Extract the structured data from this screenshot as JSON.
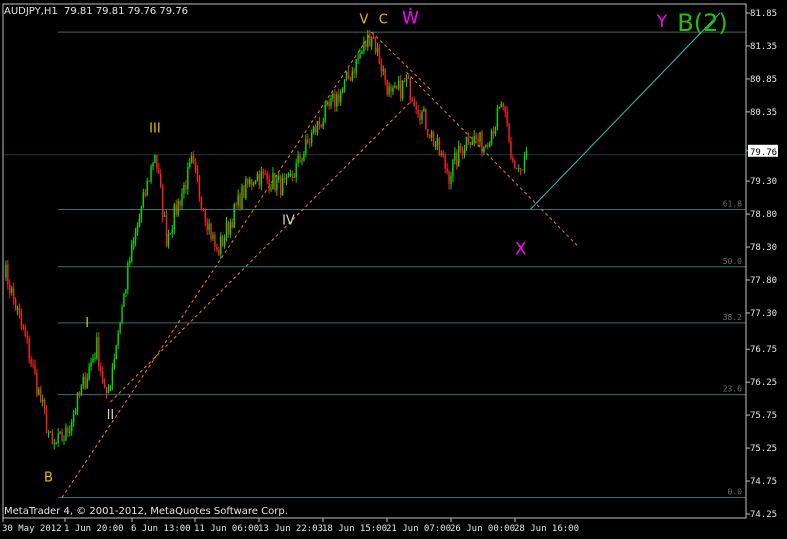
{
  "header": {
    "symbol_tf": "AUDJPY,H1",
    "ohlc": "79.81 79.81 79.76 79.76"
  },
  "footer": {
    "copyright": "MetaTrader 4, © 2001-2012, MetaQuotes Software Corp."
  },
  "colors": {
    "background": "#000000",
    "frame": "#c0c0c0",
    "bull": "#00e000",
    "bear": "#ff2020",
    "fib": "#3a6e6e",
    "fib_text": "#707070",
    "wave_main": "#e0c000",
    "wave_sub": "#d0d0d0",
    "wave_x": "#ff00ff",
    "wave_b2": "#22c000",
    "trend_dashed": "#ff8000",
    "line_cyan": "#30c0c0"
  },
  "chart_data": {
    "type": "candlestick",
    "symbol": "AUDJPY",
    "timeframe": "H1",
    "current_price": 79.76,
    "ylim": [
      74.25,
      81.85
    ],
    "y_ticks": [
      "81.85",
      "81.35",
      "80.85",
      "80.35",
      "79.76",
      "79.30",
      "78.80",
      "78.30",
      "77.80",
      "77.30",
      "76.75",
      "76.25",
      "75.75",
      "75.25",
      "74.75",
      "74.25"
    ],
    "x_ticks": [
      "30 May 2012",
      "1 Jun 20:00",
      "6 Jun 13:00",
      "11 Jun 06:00",
      "13 Jun 22:03",
      "18 Jun 15:00",
      "21 Jun 07:00",
      "26 Jun 00:00",
      "28 Jun 16:00"
    ],
    "fib_levels": [
      {
        "label": "61.8",
        "price": 78.87
      },
      {
        "label": "50.0",
        "price": 78.0
      },
      {
        "label": "38.2",
        "price": 77.15
      },
      {
        "label": "23.6",
        "price": 76.06
      },
      {
        "label": "0.0",
        "price": 74.5
      }
    ],
    "fib_high": 81.56,
    "swing_points": [
      {
        "bar": 0,
        "price": 78.0
      },
      {
        "bar": 12,
        "price": 76.8
      },
      {
        "bar": 25,
        "price": 75.25
      },
      {
        "bar": 32,
        "price": 75.45
      },
      {
        "bar": 48,
        "price": 76.8
      },
      {
        "bar": 53,
        "price": 75.95
      },
      {
        "bar": 65,
        "price": 78.1
      },
      {
        "bar": 78,
        "price": 79.75
      },
      {
        "bar": 84,
        "price": 78.45
      },
      {
        "bar": 97,
        "price": 79.55
      },
      {
        "bar": 110,
        "price": 78.2
      },
      {
        "bar": 123,
        "price": 79.1
      },
      {
        "bar": 130,
        "price": 79.4
      },
      {
        "bar": 146,
        "price": 79.2
      },
      {
        "bar": 160,
        "price": 80.05
      },
      {
        "bar": 175,
        "price": 80.7
      },
      {
        "bar": 190,
        "price": 81.55
      },
      {
        "bar": 200,
        "price": 80.55
      },
      {
        "bar": 208,
        "price": 80.8
      },
      {
        "bar": 214,
        "price": 80.45
      },
      {
        "bar": 230,
        "price": 79.4
      },
      {
        "bar": 240,
        "price": 80.0
      },
      {
        "bar": 248,
        "price": 79.85
      },
      {
        "bar": 258,
        "price": 80.45
      },
      {
        "bar": 262,
        "price": 79.6
      },
      {
        "bar": 268,
        "price": 79.45
      },
      {
        "bar": 270,
        "price": 79.76
      }
    ],
    "wave_labels": [
      {
        "text": "B",
        "bar": 23,
        "price": 74.8,
        "color": "wave_main"
      },
      {
        "text": "I",
        "bar": 43,
        "price": 77.15,
        "color": "wave_main"
      },
      {
        "text": "II",
        "bar": 55,
        "price": 75.75,
        "color": "wave_sub"
      },
      {
        "text": "III",
        "bar": 78,
        "price": 80.1,
        "color": "wave_main"
      },
      {
        "text": "IV",
        "bar": 147,
        "price": 78.7,
        "color": "wave_sub"
      },
      {
        "text": "V",
        "bar": 186,
        "price": 81.75,
        "color": "wave_main"
      },
      {
        "text": "C",
        "bar": 196,
        "price": 81.75,
        "color": "wave_main"
      },
      {
        "text": "Ẇ",
        "bar": 210,
        "price": 81.75,
        "color": "wave_x"
      },
      {
        "text": "X",
        "bar": 267,
        "price": 78.25,
        "color": "wave_x"
      },
      {
        "text": "Y",
        "bar": 340,
        "price": 81.7,
        "color": "wave_x"
      },
      {
        "text": "B(2)",
        "bar": 361,
        "price": 81.7,
        "color": "wave_b2"
      }
    ]
  }
}
